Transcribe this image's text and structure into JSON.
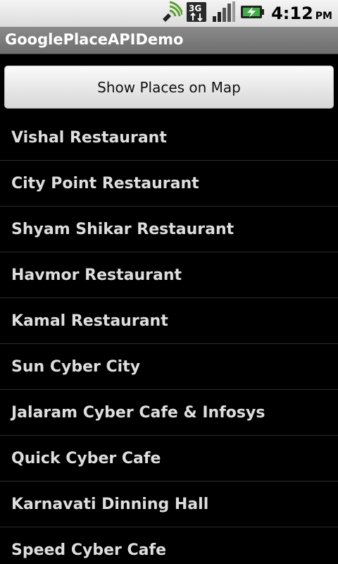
{
  "status_bar": {
    "time": "4:12",
    "ampm": "PM",
    "icons": [
      "wifi-sync-icon",
      "3g-data-icon",
      "signal-icon",
      "battery-charging-icon"
    ]
  },
  "app": {
    "title": "GooglePlaceAPIDemo"
  },
  "actions": {
    "show_map_label": "Show Places on Map"
  },
  "places": [
    "Vishal Restaurant",
    "City Point Restaurant",
    "Shyam Shikar Restaurant",
    "Havmor Restaurant",
    "Kamal Restaurant",
    "Sun Cyber City",
    "Jalaram Cyber Cafe & Infosys",
    "Quick Cyber Cafe",
    "Karnavati Dinning Hall",
    "Speed Cyber Cafe"
  ],
  "colors": {
    "background": "#000000",
    "title_bar": "#7b7b7b",
    "list_text": "#dedede",
    "divider": "#2e2e2e",
    "battery_accent": "#3cb043"
  }
}
